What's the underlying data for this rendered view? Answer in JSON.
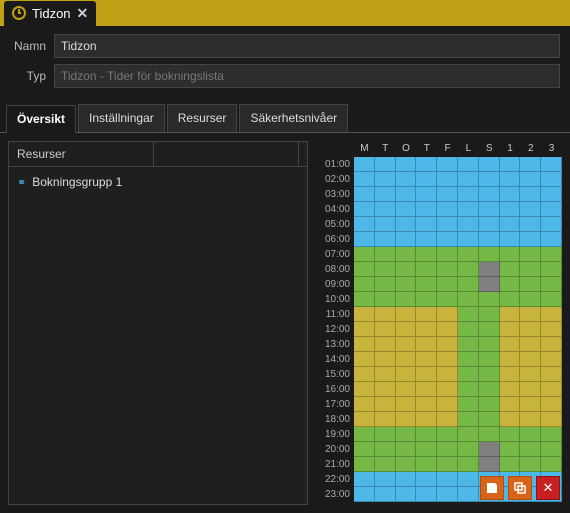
{
  "tab": {
    "title": "Tidzon"
  },
  "form": {
    "name_label": "Namn",
    "name_value": "Tidzon",
    "type_label": "Typ",
    "type_value": "Tidzon - Tider för bokningslista"
  },
  "nav": {
    "tabs": [
      "Översikt",
      "Inställningar",
      "Resurser",
      "Säkerhetsnivåer"
    ],
    "active": 0
  },
  "panel": {
    "header": "Resurser",
    "items": [
      "Bokningsgrupp 1"
    ]
  },
  "schedule": {
    "days": [
      "M",
      "T",
      "O",
      "T",
      "F",
      "L",
      "S",
      "1",
      "2",
      "3"
    ],
    "hours": [
      "01:00",
      "02:00",
      "03:00",
      "04:00",
      "05:00",
      "06:00",
      "07:00",
      "08:00",
      "09:00",
      "10:00",
      "11:00",
      "12:00",
      "13:00",
      "14:00",
      "15:00",
      "16:00",
      "17:00",
      "18:00",
      "19:00",
      "20:00",
      "21:00",
      "22:00",
      "23:00"
    ]
  },
  "chart_data": {
    "type": "heatmap",
    "title": "",
    "x_categories": [
      "M",
      "T",
      "O",
      "T",
      "F",
      "L",
      "S",
      "1",
      "2",
      "3"
    ],
    "y_categories": [
      "01:00",
      "02:00",
      "03:00",
      "04:00",
      "05:00",
      "06:00",
      "07:00",
      "08:00",
      "09:00",
      "10:00",
      "11:00",
      "12:00",
      "13:00",
      "14:00",
      "15:00",
      "16:00",
      "17:00",
      "18:00",
      "19:00",
      "20:00",
      "21:00",
      "22:00",
      "23:00"
    ],
    "legend": {
      "blue": "#4db8e8",
      "green": "#76b846",
      "yellow": "#c8b43c",
      "gray": "#808080"
    },
    "grid": [
      [
        "blue",
        "blue",
        "blue",
        "blue",
        "blue",
        "blue",
        "blue",
        "blue",
        "blue",
        "blue"
      ],
      [
        "blue",
        "blue",
        "blue",
        "blue",
        "blue",
        "blue",
        "blue",
        "blue",
        "blue",
        "blue"
      ],
      [
        "blue",
        "blue",
        "blue",
        "blue",
        "blue",
        "blue",
        "blue",
        "blue",
        "blue",
        "blue"
      ],
      [
        "blue",
        "blue",
        "blue",
        "blue",
        "blue",
        "blue",
        "blue",
        "blue",
        "blue",
        "blue"
      ],
      [
        "blue",
        "blue",
        "blue",
        "blue",
        "blue",
        "blue",
        "blue",
        "blue",
        "blue",
        "blue"
      ],
      [
        "blue",
        "blue",
        "blue",
        "blue",
        "blue",
        "blue",
        "blue",
        "blue",
        "blue",
        "blue"
      ],
      [
        "green",
        "green",
        "green",
        "green",
        "green",
        "green",
        "green",
        "green",
        "green",
        "green"
      ],
      [
        "green",
        "green",
        "green",
        "green",
        "green",
        "green",
        "gray",
        "green",
        "green",
        "green"
      ],
      [
        "green",
        "green",
        "green",
        "green",
        "green",
        "green",
        "gray",
        "green",
        "green",
        "green"
      ],
      [
        "green",
        "green",
        "green",
        "green",
        "green",
        "green",
        "green",
        "green",
        "green",
        "green"
      ],
      [
        "yellow",
        "yellow",
        "yellow",
        "yellow",
        "yellow",
        "green",
        "green",
        "yellow",
        "yellow",
        "yellow"
      ],
      [
        "yellow",
        "yellow",
        "yellow",
        "yellow",
        "yellow",
        "green",
        "green",
        "yellow",
        "yellow",
        "yellow"
      ],
      [
        "yellow",
        "yellow",
        "yellow",
        "yellow",
        "yellow",
        "green",
        "green",
        "yellow",
        "yellow",
        "yellow"
      ],
      [
        "yellow",
        "yellow",
        "yellow",
        "yellow",
        "yellow",
        "green",
        "green",
        "yellow",
        "yellow",
        "yellow"
      ],
      [
        "yellow",
        "yellow",
        "yellow",
        "yellow",
        "yellow",
        "green",
        "green",
        "yellow",
        "yellow",
        "yellow"
      ],
      [
        "yellow",
        "yellow",
        "yellow",
        "yellow",
        "yellow",
        "green",
        "green",
        "yellow",
        "yellow",
        "yellow"
      ],
      [
        "yellow",
        "yellow",
        "yellow",
        "yellow",
        "yellow",
        "green",
        "green",
        "yellow",
        "yellow",
        "yellow"
      ],
      [
        "yellow",
        "yellow",
        "yellow",
        "yellow",
        "yellow",
        "green",
        "green",
        "yellow",
        "yellow",
        "yellow"
      ],
      [
        "green",
        "green",
        "green",
        "green",
        "green",
        "green",
        "green",
        "green",
        "green",
        "green"
      ],
      [
        "green",
        "green",
        "green",
        "green",
        "green",
        "green",
        "gray",
        "green",
        "green",
        "green"
      ],
      [
        "green",
        "green",
        "green",
        "green",
        "green",
        "green",
        "gray",
        "green",
        "green",
        "green"
      ],
      [
        "blue",
        "blue",
        "blue",
        "blue",
        "blue",
        "blue",
        "blue",
        "blue",
        "blue",
        "blue"
      ],
      [
        "blue",
        "blue",
        "blue",
        "blue",
        "blue",
        "blue",
        "blue",
        "blue",
        "blue",
        "blue"
      ]
    ]
  },
  "colors": {
    "accent": "#c0a014",
    "button": "#d8641a",
    "close": "#c82020"
  }
}
